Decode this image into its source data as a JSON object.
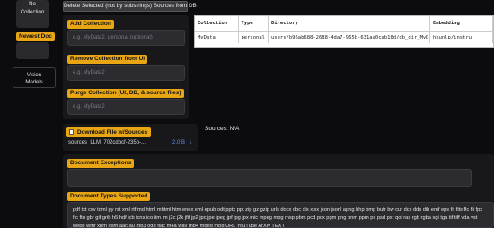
{
  "sidebar": {
    "collection_label": "No\nCollection",
    "newest_doc_label": "Newest Doc",
    "vision_models_label": "Vision\nModels"
  },
  "actions": {
    "delete_selected_label": "Delete Selected (not by substrings) Sources from DB"
  },
  "add_collection": {
    "label": "Add Collection",
    "placeholder": "e.g. MyData2, personal (optional)"
  },
  "remove_collection": {
    "label": "Remove Collection from UI",
    "placeholder": "e.g. MyData2"
  },
  "purge_collection": {
    "label": "Purge Collection (UI, DB, & source files)",
    "placeholder": "e.g. MyData2"
  },
  "collections_table": {
    "headers": [
      "Collection",
      "Type",
      "Directory",
      "Embedding"
    ],
    "rows": [
      [
        "MyData",
        "personal",
        "users/b96ab688-2688-4da7-965b-631aa0cab18d/db_dir_MyData",
        "hkunlp/instru"
      ]
    ]
  },
  "download": {
    "button_label": "Download File w/Sources",
    "file_name": "sources_LLM_702cdbcf-235b-...",
    "file_size": "2.0 B",
    "download_icon": "download-arrow-icon"
  },
  "sources_status": "Sources: N/A",
  "document_exceptions": {
    "label": "Document Exceptions",
    "value": ""
  },
  "document_types": {
    "label": "Document Types Supported",
    "value": "pdf txt csv toml py rst xml rtf md html mhtml htm enex eml epub odt pptx ppt zip gz gzip urls docx doc xls xlsx json jsonl apng bhp bmp bufr bw cur dcx dds dib emf eps fit fits flc fli fpx ftc ftu gbr gif grib h5 hdf icb icns ico iim im j2c j2k jfif jp2 jpc jpe jpeg jpf jpg jpx mic mpeg mpg msp pbm pcd pcx pgm png pnm ppm ps psd pxr qoi ras rgb rgba sgi tga tif tiff vda vst webp wmf xbm xpm aac au mp3 ogg flac m4a wav mp4 mpeg mpg URL YouTube ArXiv TEXT"
  },
  "colors": {
    "accent": "#e8a615",
    "background": "#0c0c0e",
    "panel": "#18181b",
    "input": "#2b2b30",
    "link": "#6b8df0"
  }
}
